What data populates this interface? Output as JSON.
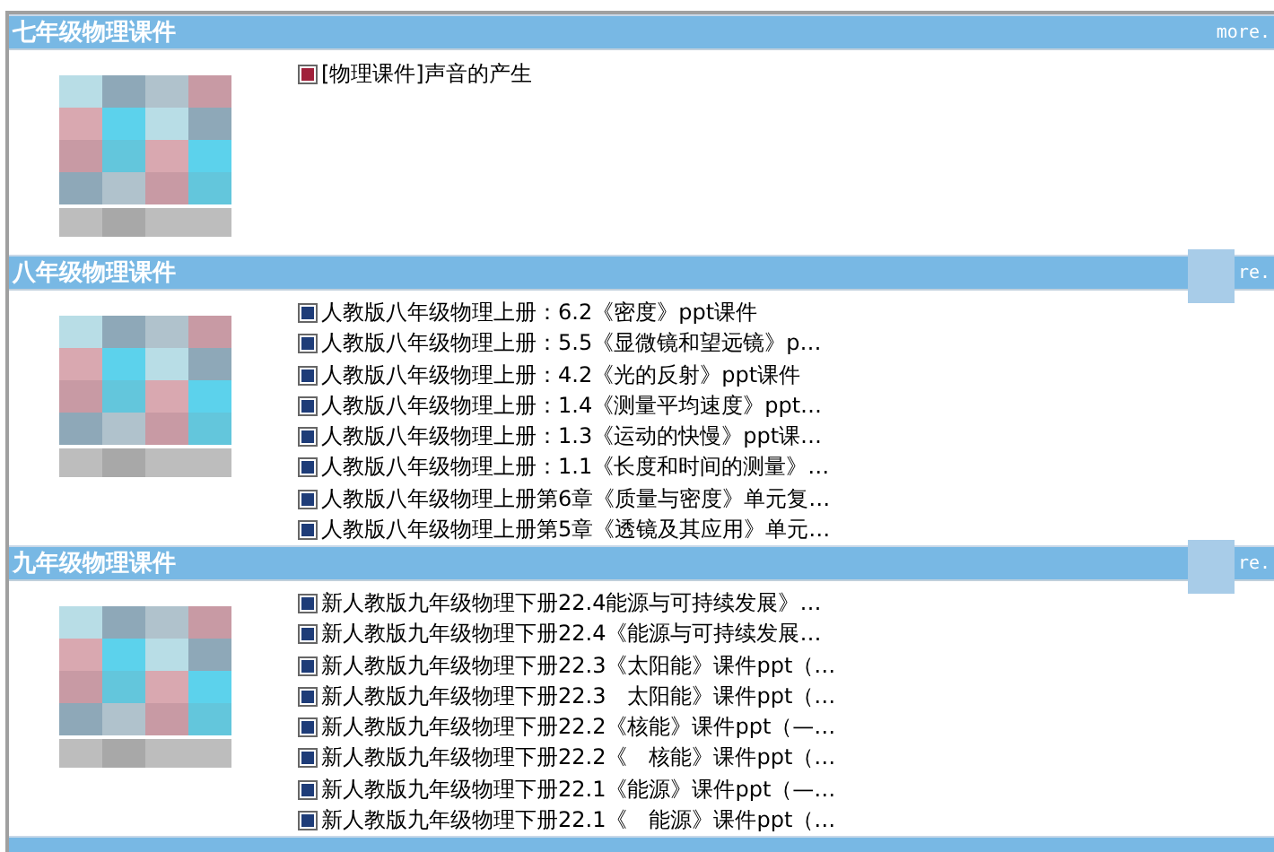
{
  "sections": [
    {
      "title": "七年级物理课件",
      "more": "more.",
      "more_covered": false,
      "color": "#a0203a",
      "items": [
        "[物理课件]声音的产生"
      ]
    },
    {
      "title": "八年级物理课件",
      "more": "re.",
      "more_covered": true,
      "color": "#1e3c78",
      "items": [
        "人教版八年级物理上册：6.2《密度》ppt课件",
        "人教版八年级物理上册：5.5《显微镜和望远镜》p…",
        "人教版八年级物理上册：4.2《光的反射》ppt课件",
        "人教版八年级物理上册：1.4《测量平均速度》ppt…",
        "人教版八年级物理上册：1.3《运动的快慢》ppt课…",
        "人教版八年级物理上册：1.1《长度和时间的测量》…",
        "人教版八年级物理上册第6章《质量与密度》单元复…",
        "人教版八年级物理上册第5章《透镜及其应用》单元…"
      ]
    },
    {
      "title": "九年级物理课件",
      "more": "re.",
      "more_covered": true,
      "color": "#1e3c78",
      "items": [
        "新人教版九年级物理下册22.4能源与可持续发展》…",
        "新人教版九年级物理下册22.4《能源与可持续发展…",
        "新人教版九年级物理下册22.3《太阳能》课件ppt（…",
        "新人教版九年级物理下册22.3　太阳能》课件ppt（…",
        "新人教版九年级物理下册22.2《核能》课件ppt（—…",
        "新人教版九年级物理下册22.2《　核能》课件ppt（…",
        "新人教版九年级物理下册22.1《能源》课件ppt（—…",
        "新人教版九年级物理下册22.1《　能源》课件ppt（…"
      ]
    }
  ]
}
